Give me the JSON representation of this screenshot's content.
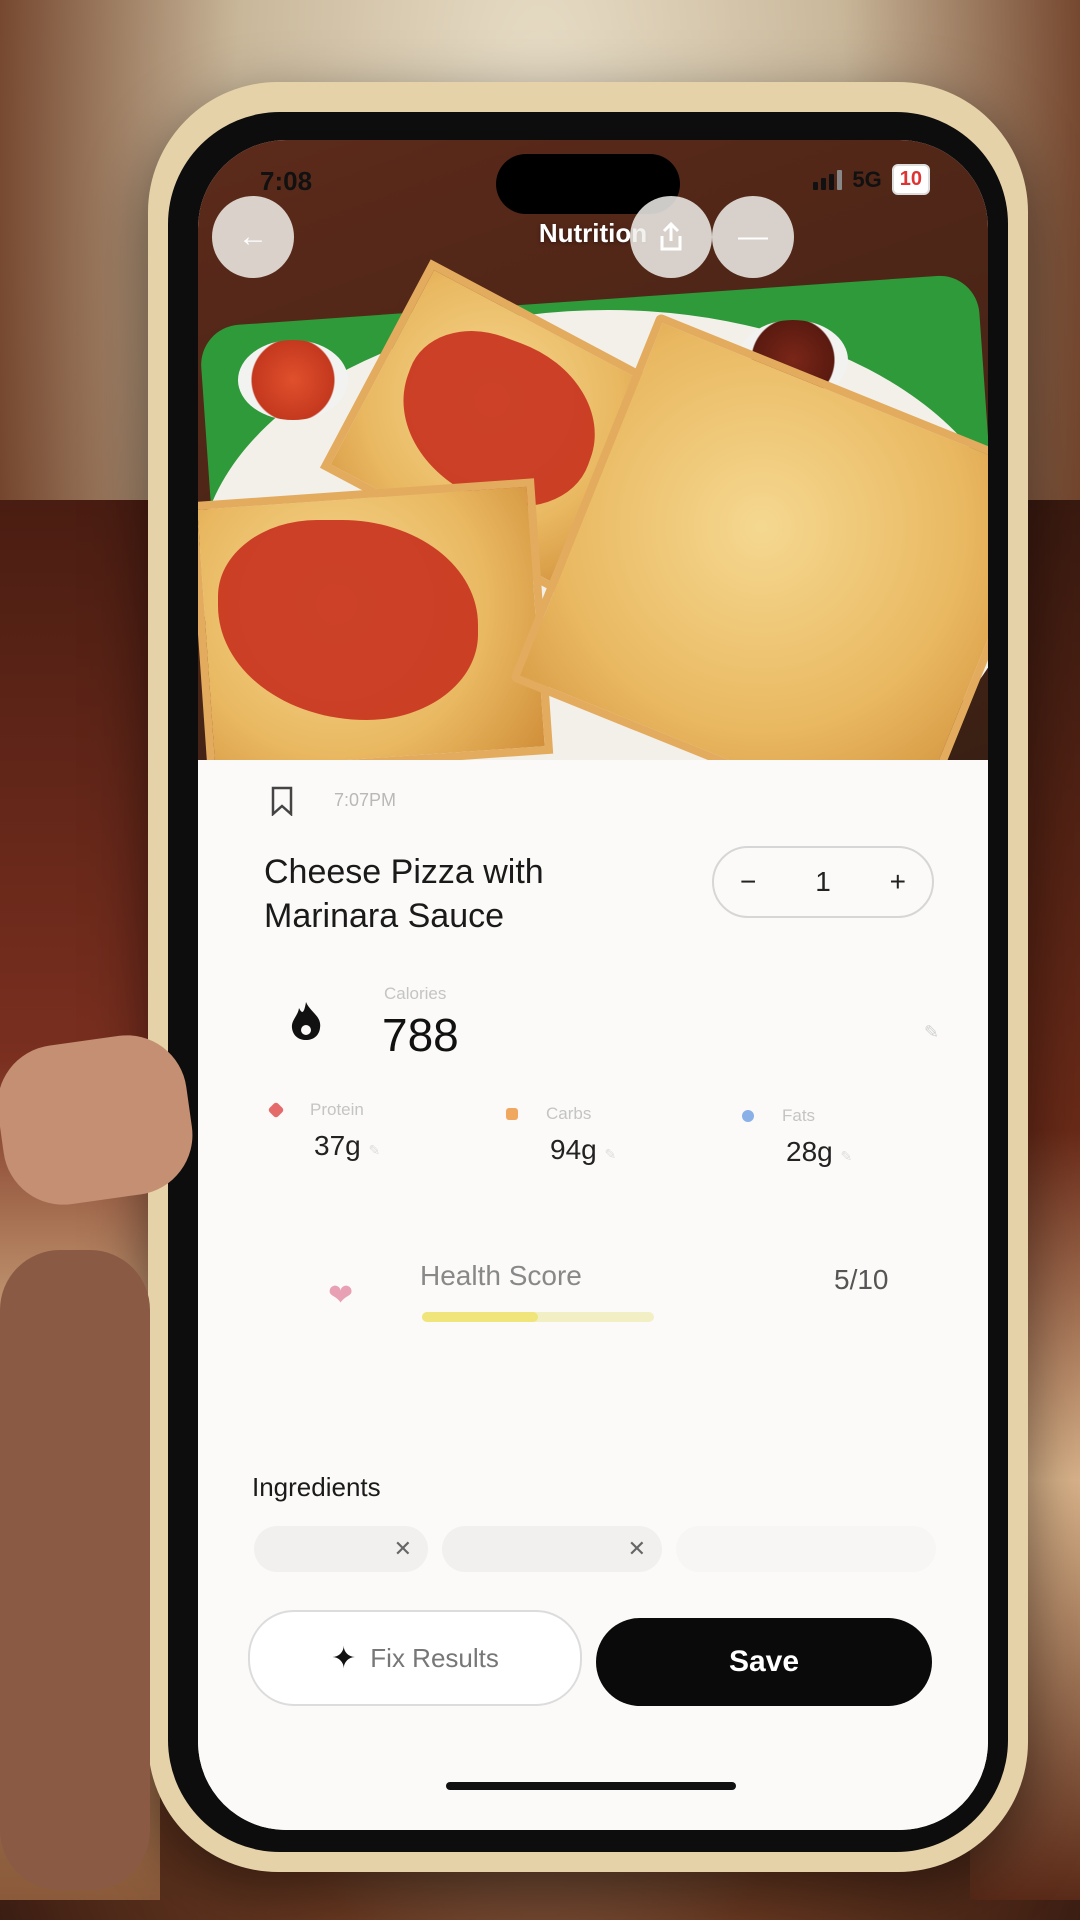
{
  "status_bar": {
    "time": "7:08",
    "network": "5G",
    "battery": "10"
  },
  "nav": {
    "title": "Nutrition",
    "back_icon": "arrow-left-icon",
    "share_icon": "share-icon",
    "more_icon": "more-icon"
  },
  "entry": {
    "time": "7:07PM",
    "food_name": "Cheese Pizza with Marinara Sauce",
    "quantity": "1",
    "minus": "−",
    "plus": "+"
  },
  "calories": {
    "label": "Calories",
    "value": "788"
  },
  "macros": [
    {
      "label": "Protein",
      "value": "37g",
      "color": "#e56a6a"
    },
    {
      "label": "Carbs",
      "value": "94g",
      "color": "#f0a860"
    },
    {
      "label": "Fats",
      "value": "28g",
      "color": "#8ab0e8"
    }
  ],
  "health": {
    "label": "Health Score",
    "score": "5/10",
    "fraction": 0.5
  },
  "ingredients": {
    "title": "Ingredients"
  },
  "actions": {
    "fix_label": "Fix Results",
    "save_label": "Save"
  },
  "colors": {
    "accent": "#0a0a0a",
    "health_bar": "#efe57a"
  }
}
